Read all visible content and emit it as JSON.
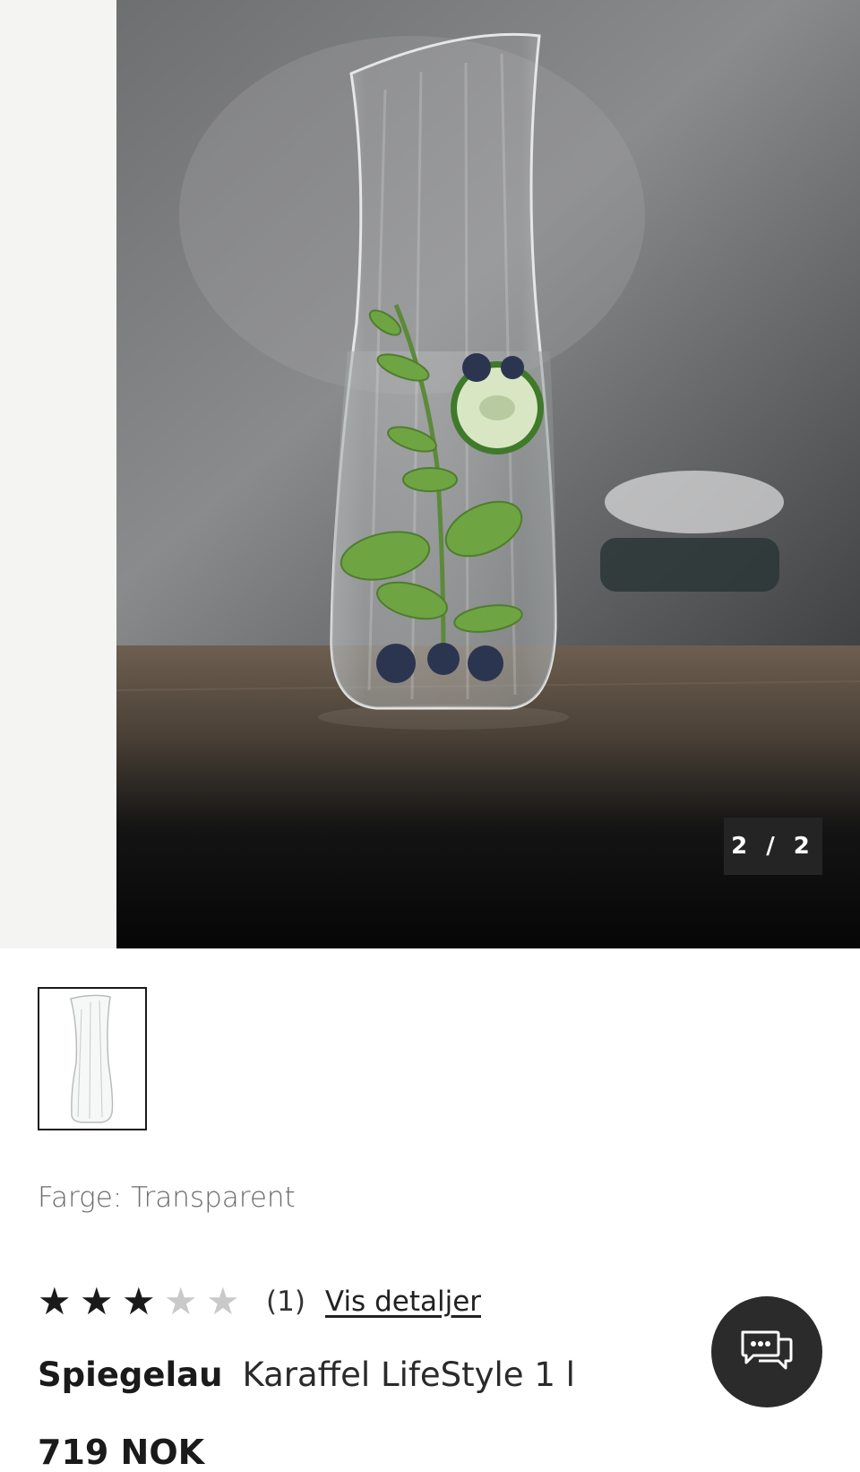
{
  "gallery": {
    "counter": "2 / 2",
    "current_index": 2,
    "total": 2
  },
  "product": {
    "color_label": "Farge: Transparent",
    "rating": 3,
    "rating_max": 5,
    "review_count": "(1)",
    "details_link": "Vis detaljer",
    "brand": "Spiegelau",
    "name": "Karaffel LifeStyle 1 l",
    "price": "719 NOK"
  },
  "colors": {
    "star_filled": "#1a1a1a",
    "star_empty": "#c9c9c9",
    "chat_button": "#2b2b2b"
  },
  "icons": {
    "chat": "chat-bubbles-icon",
    "star": "star-icon"
  }
}
